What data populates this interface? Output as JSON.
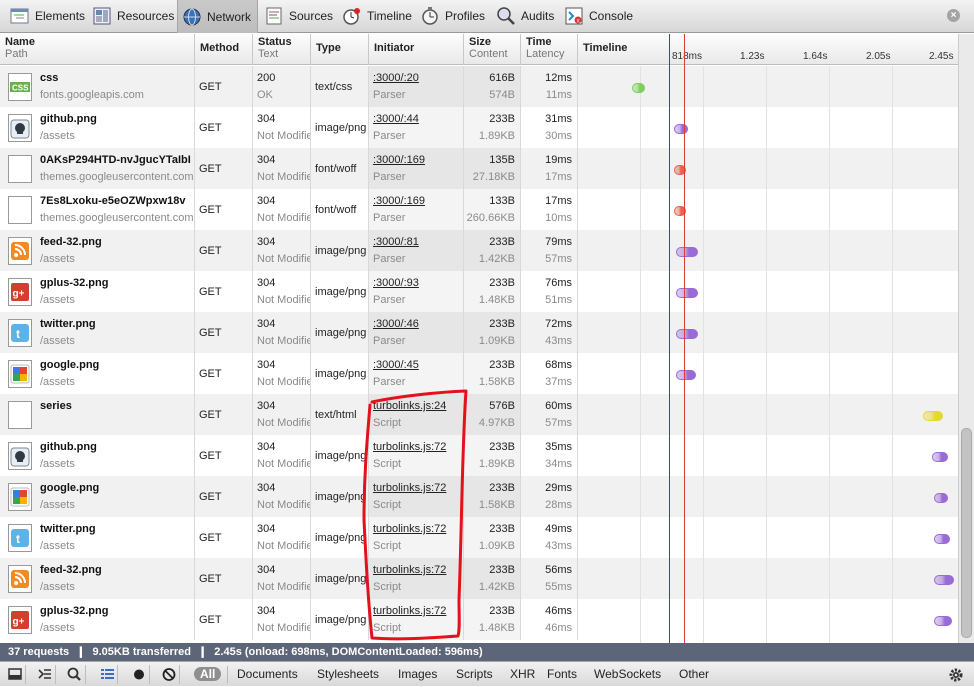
{
  "toolbar": {
    "tabs": [
      {
        "label": "Elements",
        "icon": "elements-icon"
      },
      {
        "label": "Resources",
        "icon": "resources-icon"
      },
      {
        "label": "Network",
        "icon": "network-icon"
      },
      {
        "label": "Sources",
        "icon": "sources-icon"
      },
      {
        "label": "Timeline",
        "icon": "timeline-icon"
      },
      {
        "label": "Profiles",
        "icon": "profiles-icon"
      },
      {
        "label": "Audits",
        "icon": "audits-icon"
      },
      {
        "label": "Console",
        "icon": "console-icon"
      }
    ],
    "active_tab": "Network",
    "close_icon": "close-icon"
  },
  "columns": {
    "name": {
      "title": "Name",
      "sub": "Path"
    },
    "method": {
      "title": "Method"
    },
    "status": {
      "title": "Status",
      "sub": "Text"
    },
    "type": {
      "title": "Type"
    },
    "initiator": {
      "title": "Initiator"
    },
    "size": {
      "title": "Size",
      "sub": "Content"
    },
    "time": {
      "title": "Time",
      "sub": "Latency"
    },
    "timeline": {
      "title": "Timeline",
      "ticks": [
        "818ms",
        "1.23s",
        "1.64s",
        "2.05s",
        "2.45s"
      ]
    }
  },
  "requests": [
    {
      "name": "css",
      "path": "fonts.googleapis.com",
      "method": "GET",
      "status": "200",
      "status_text": "OK",
      "type": "text/css",
      "initiator": ":3000/:20",
      "initiator_type": "Parser",
      "size": "616B",
      "content": "574B",
      "time": "12ms",
      "latency": "11ms",
      "icon": "css-file-icon",
      "bar_color": "#7fcf5a"
    },
    {
      "name": "github.png",
      "path": "/assets",
      "method": "GET",
      "status": "304",
      "status_text": "Not Modified",
      "type": "image/png",
      "initiator": ":3000/:44",
      "initiator_type": "Parser",
      "size": "233B",
      "content": "1.89KB",
      "time": "31ms",
      "latency": "30ms",
      "icon": "github-icon",
      "bar_color": "#9a6bd6"
    },
    {
      "name": "0AKsP294HTD-nvJgucYTaIbI",
      "path": "themes.googleusercontent.com",
      "method": "GET",
      "status": "304",
      "status_text": "Not Modified",
      "type": "font/woff",
      "initiator": ":3000/:169",
      "initiator_type": "Parser",
      "size": "135B",
      "content": "27.18KB",
      "time": "19ms",
      "latency": "17ms",
      "icon": "blank-file-icon",
      "bar_color": "#e85f4f"
    },
    {
      "name": "7Es8Lxoku-e5eOZWpxw18v",
      "path": "themes.googleusercontent.com",
      "method": "GET",
      "status": "304",
      "status_text": "Not Modified",
      "type": "font/woff",
      "initiator": ":3000/:169",
      "initiator_type": "Parser",
      "size": "133B",
      "content": "260.66KB",
      "time": "17ms",
      "latency": "10ms",
      "icon": "blank-file-icon",
      "bar_color": "#e85f4f"
    },
    {
      "name": "feed-32.png",
      "path": "/assets",
      "method": "GET",
      "status": "304",
      "status_text": "Not Modified",
      "type": "image/png",
      "initiator": ":3000/:81",
      "initiator_type": "Parser",
      "size": "233B",
      "content": "1.42KB",
      "time": "79ms",
      "latency": "57ms",
      "icon": "rss-feed-icon",
      "bar_color": "#9a6bd6"
    },
    {
      "name": "gplus-32.png",
      "path": "/assets",
      "method": "GET",
      "status": "304",
      "status_text": "Not Modified",
      "type": "image/png",
      "initiator": ":3000/:93",
      "initiator_type": "Parser",
      "size": "233B",
      "content": "1.48KB",
      "time": "76ms",
      "latency": "51ms",
      "icon": "google-plus-icon",
      "bar_color": "#9a6bd6"
    },
    {
      "name": "twitter.png",
      "path": "/assets",
      "method": "GET",
      "status": "304",
      "status_text": "Not Modified",
      "type": "image/png",
      "initiator": ":3000/:46",
      "initiator_type": "Parser",
      "size": "233B",
      "content": "1.09KB",
      "time": "72ms",
      "latency": "43ms",
      "icon": "twitter-icon",
      "bar_color": "#9a6bd6"
    },
    {
      "name": "google.png",
      "path": "/assets",
      "method": "GET",
      "status": "304",
      "status_text": "Not Modified",
      "type": "image/png",
      "initiator": ":3000/:45",
      "initiator_type": "Parser",
      "size": "233B",
      "content": "1.58KB",
      "time": "68ms",
      "latency": "37ms",
      "icon": "google-icon",
      "bar_color": "#9a6bd6"
    },
    {
      "name": "series",
      "path": "",
      "method": "GET",
      "status": "304",
      "status_text": "Not Modified",
      "type": "text/html",
      "initiator": "turbolinks.js:24",
      "initiator_type": "Script",
      "size": "576B",
      "content": "4.97KB",
      "time": "60ms",
      "latency": "57ms",
      "icon": "blank-file-icon",
      "bar_color": "#e5d92e"
    },
    {
      "name": "github.png",
      "path": "/assets",
      "method": "GET",
      "status": "304",
      "status_text": "Not Modified",
      "type": "image/png",
      "initiator": "turbolinks.js:72",
      "initiator_type": "Script",
      "size": "233B",
      "content": "1.89KB",
      "time": "35ms",
      "latency": "34ms",
      "icon": "github-icon",
      "bar_color": "#9a6bd6"
    },
    {
      "name": "google.png",
      "path": "/assets",
      "method": "GET",
      "status": "304",
      "status_text": "Not Modified",
      "type": "image/png",
      "initiator": "turbolinks.js:72",
      "initiator_type": "Script",
      "size": "233B",
      "content": "1.58KB",
      "time": "29ms",
      "latency": "28ms",
      "icon": "google-icon",
      "bar_color": "#9a6bd6"
    },
    {
      "name": "twitter.png",
      "path": "/assets",
      "method": "GET",
      "status": "304",
      "status_text": "Not Modified",
      "type": "image/png",
      "initiator": "turbolinks.js:72",
      "initiator_type": "Script",
      "size": "233B",
      "content": "1.09KB",
      "time": "49ms",
      "latency": "43ms",
      "icon": "twitter-icon",
      "bar_color": "#9a6bd6"
    },
    {
      "name": "feed-32.png",
      "path": "/assets",
      "method": "GET",
      "status": "304",
      "status_text": "Not Modified",
      "type": "image/png",
      "initiator": "turbolinks.js:72",
      "initiator_type": "Script",
      "size": "233B",
      "content": "1.42KB",
      "time": "56ms",
      "latency": "55ms",
      "icon": "rss-feed-icon",
      "bar_color": "#9a6bd6"
    },
    {
      "name": "gplus-32.png",
      "path": "/assets",
      "method": "GET",
      "status": "304",
      "status_text": "Not Modified",
      "type": "image/png",
      "initiator": "turbolinks.js:72",
      "initiator_type": "Script",
      "size": "233B",
      "content": "1.48KB",
      "time": "46ms",
      "latency": "46ms",
      "icon": "google-plus-icon",
      "bar_color": "#9a6bd6"
    }
  ],
  "timeline_markers": {
    "dom_content_loaded_color": "#3b3bd8",
    "onload_color": "#e03b3b"
  },
  "summary": {
    "requests": "37 requests",
    "transferred": "9.05KB transferred",
    "timing": "2.45s (onload: 698ms, DOMContentLoaded: 596ms)",
    "separator": "❙"
  },
  "statusbar": {
    "buttons": [
      "dock-icon",
      "console-toggle-icon",
      "search-icon",
      "large-rows-icon",
      "record-icon",
      "clear-icon"
    ],
    "filters": [
      "All",
      "Documents",
      "Stylesheets",
      "Images",
      "Scripts",
      "XHR",
      "Fonts",
      "WebSockets",
      "Other"
    ],
    "settings_icon": "gear-icon"
  }
}
